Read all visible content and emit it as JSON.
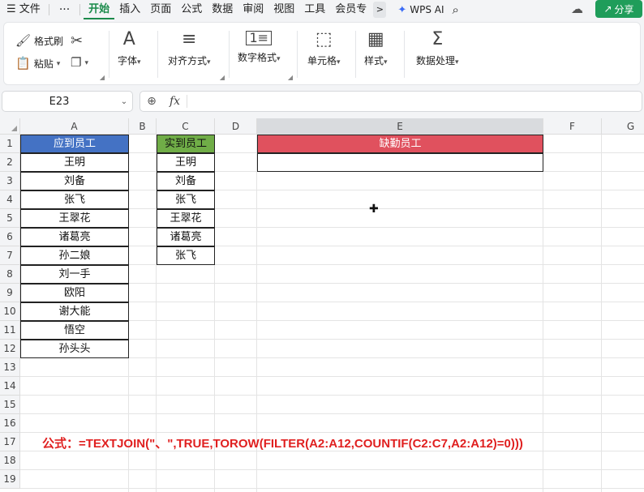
{
  "menu": {
    "file_icon": "menu-icon",
    "file_label": "文件",
    "more_label": "···",
    "tabs": [
      "开始",
      "插入",
      "页面",
      "公式",
      "数据",
      "审阅",
      "视图",
      "工具",
      "会员专"
    ],
    "active_tab": "开始",
    "chevron": ">",
    "wps_ai_logo": "✦",
    "wps_ai_label": "WPS AI",
    "search_icon": "search-icon",
    "share_label": "分享"
  },
  "ribbon": {
    "format_painter": "格式刷",
    "paste": "粘贴",
    "font": "字体",
    "align": "对齐方式",
    "number_format": "数字格式",
    "cell": "单元格",
    "style": "样式",
    "data_process": "数据处理"
  },
  "formula_bar": {
    "name_box": "E23",
    "fx_label": "fx",
    "formula": ""
  },
  "grid": {
    "columns": [
      "A",
      "B",
      "C",
      "D",
      "E",
      "F",
      "G"
    ],
    "selected_column": "E",
    "rows": [
      "1",
      "2",
      "3",
      "4",
      "5",
      "6",
      "7",
      "8",
      "9",
      "10",
      "11",
      "12",
      "13",
      "14",
      "15",
      "16",
      "17",
      "18",
      "19"
    ]
  },
  "table_a": {
    "header": "应到员工",
    "names": [
      "王明",
      "刘备",
      "张飞",
      "王翠花",
      "诸葛亮",
      "孙二娘",
      "刘一手",
      "欧阳",
      "谢大能",
      "悟空",
      "孙头头"
    ]
  },
  "table_c": {
    "header": "实到员工",
    "names": [
      "王明",
      "刘备",
      "张飞",
      "王翠花",
      "诸葛亮",
      "张飞"
    ]
  },
  "table_e": {
    "header": "缺勤员工",
    "value": ""
  },
  "note": "公式：=TEXTJOIN(\"、\",TRUE,TOROW(FILTER(A2:A12,COUNTIF(C2:C7,A2:A12)=0)))",
  "colors": {
    "accent": "#1a8a4a",
    "header_blue": "#4472c4",
    "header_green": "#70ad47",
    "header_red": "#e0515e",
    "note_red": "#e02020"
  }
}
